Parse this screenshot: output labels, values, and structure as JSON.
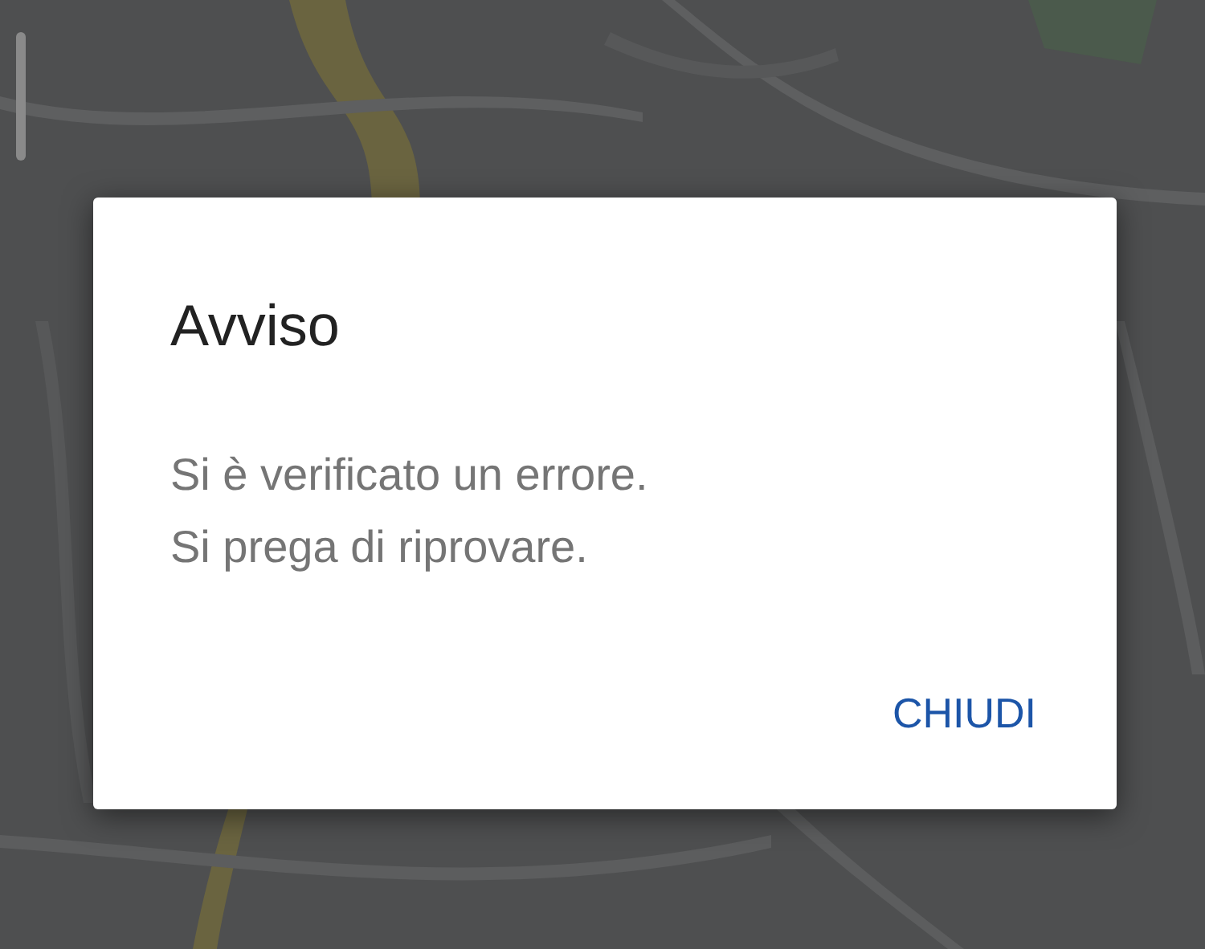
{
  "dialog": {
    "title": "Avviso",
    "message_lines": [
      "Si è verificato un errore.",
      "Si prega di riprovare."
    ],
    "buttons": [
      "CHIUDI"
    ]
  }
}
